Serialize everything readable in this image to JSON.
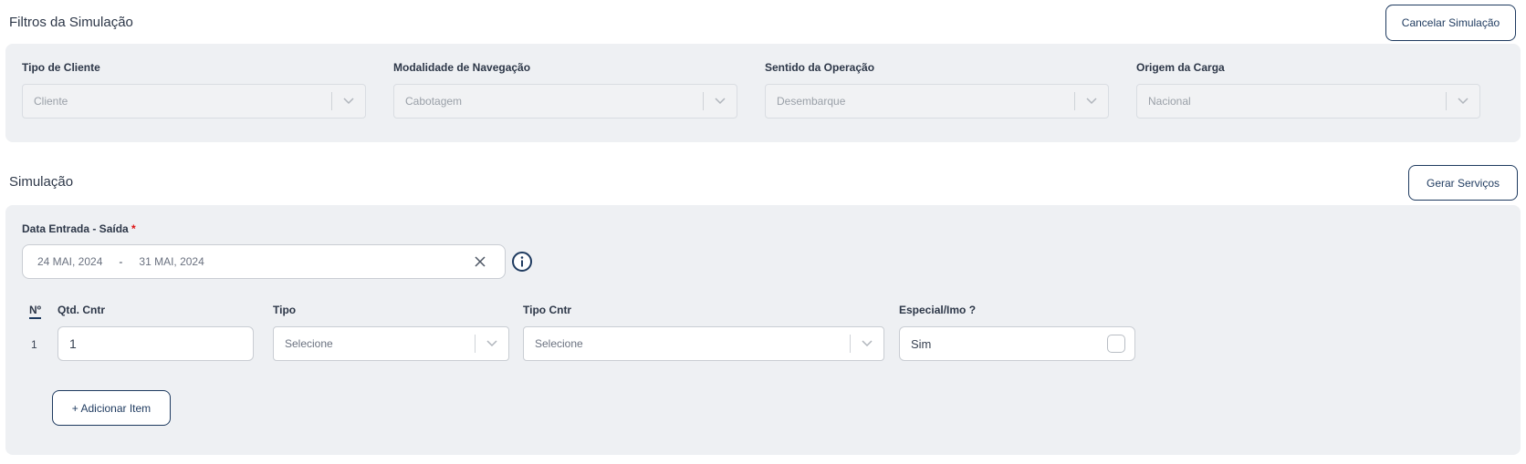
{
  "filters": {
    "title": "Filtros da Simulação",
    "cancel_label": "Cancelar Simulação",
    "fields": [
      {
        "label": "Tipo de Cliente",
        "value": "Cliente"
      },
      {
        "label": "Modalidade de Navegação",
        "value": "Cabotagem"
      },
      {
        "label": "Sentido da Operação",
        "value": "Desembarque"
      },
      {
        "label": "Origem da Carga",
        "value": "Nacional"
      }
    ]
  },
  "simulation": {
    "title": "Simulação",
    "generate_label": "Gerar Serviços",
    "date": {
      "label": "Data Entrada - Saída",
      "required_mark": "*",
      "start": "24 MAI, 2024",
      "separator": "-",
      "end": "31 MAI, 2024"
    },
    "items": {
      "headers": {
        "num": "Nº",
        "qty": "Qtd. Cntr",
        "tipo": "Tipo",
        "tipo_cntr": "Tipo Cntr",
        "especial": "Especial/Imo ?"
      },
      "rows": [
        {
          "num": "1",
          "qty": "1",
          "tipo": "Selecione",
          "tipo_cntr": "Selecione",
          "especial": "Sim"
        }
      ]
    },
    "add_item_label": "+ Adicionar Item"
  },
  "icons": {
    "chevron": "chevron-down-icon",
    "clear": "close-icon",
    "info": "info-icon"
  },
  "colors": {
    "accent": "#1e3a5f",
    "panel": "#eef0f3",
    "required": "#dd1111"
  }
}
